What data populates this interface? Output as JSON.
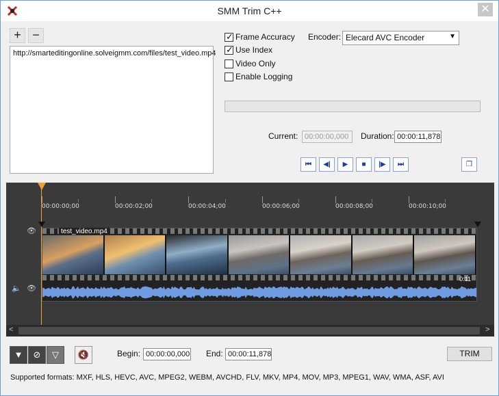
{
  "window": {
    "title": "SMM Trim C++",
    "close_glyph": "✕"
  },
  "list_toolbar": {
    "add_glyph": "+",
    "remove_glyph": "−"
  },
  "url_list": {
    "items": [
      "http://smarteditingonline.solveigmm.com/files/test_video.mp4"
    ]
  },
  "options": {
    "frame_accuracy": {
      "label": "Frame Accuracy",
      "checked": true
    },
    "use_index": {
      "label": "Use Index",
      "checked": true
    },
    "video_only": {
      "label": "Video Only",
      "checked": false
    },
    "enable_logging": {
      "label": "Enable Logging",
      "checked": false
    }
  },
  "encoder": {
    "label": "Encoder:",
    "selected": "Elecard AVC Encoder"
  },
  "progress": {
    "value": 0
  },
  "time": {
    "current_label": "Current:",
    "current_value": "00:00:00,000",
    "duration_label": "Duration:",
    "duration_value": "00:00:11,878"
  },
  "transport": {
    "first": "⏮",
    "prev": "◀|",
    "play": "▶",
    "stop": "■",
    "next": "|▶",
    "last": "⏭",
    "window_toggle": "❐"
  },
  "timeline": {
    "tick_labels": [
      "00:00:00;00",
      "00:00:02;00",
      "00:00:04;00",
      "00:00:06;00",
      "00:00:08;00",
      "00:00:10;00"
    ],
    "clip": {
      "name": "test_video.mp4",
      "duration": "0:11"
    }
  },
  "bottom": {
    "begin_label": "Begin:",
    "begin_value": "00:00:00,000",
    "end_label": "End:",
    "end_value": "00:00:11,878",
    "trim_label": "TRIM",
    "formats": "Supported formats: MXF, HLS, HEVC, AVC, MPEG2, WEBM, AVCHD, FLV, MKV, MP4, MOV, MP3, MPEG1, WAV, WMA, ASF, AVI"
  },
  "colors": {
    "accent_playhead": "#f0a030",
    "audio_wave": "#6f9be0",
    "timeline_bg": "#3a3a3a"
  }
}
